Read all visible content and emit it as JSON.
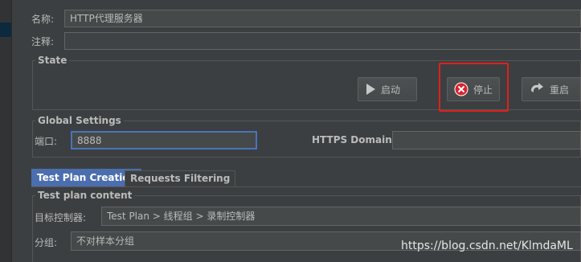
{
  "name_row": {
    "label": "名称:",
    "value": "HTTP代理服务器"
  },
  "comment_row": {
    "label": "注释:",
    "value": ""
  },
  "state": {
    "title": "State",
    "start_label": "启动",
    "stop_label": "停止",
    "restart_label": "重启"
  },
  "global_settings": {
    "title": "Global Settings",
    "port_label": "端口:",
    "port_value": "8888",
    "https_label": "HTTPS Domains:",
    "https_value": ""
  },
  "tabs": [
    {
      "label": "Test Plan Creation",
      "active": true
    },
    {
      "label": "Requests Filtering",
      "active": false
    }
  ],
  "test_plan_content": {
    "title": "Test plan content",
    "target_label": "目标控制器:",
    "target_value": "Test Plan > 线程组 > 录制控制器",
    "grouping_label": "分组:",
    "grouping_value": "不对样本分组"
  },
  "watermark": "https://blog.csdn.net/KlmdaML",
  "colors": {
    "background": "#3c3f41",
    "field": "#45494a",
    "active_tab": "#4b6eaf",
    "highlight": "#e0201c",
    "stop_icon": "#d9232d"
  },
  "icons": {
    "start": "play-icon",
    "stop": "stop-x-icon",
    "restart": "restart-icon"
  }
}
